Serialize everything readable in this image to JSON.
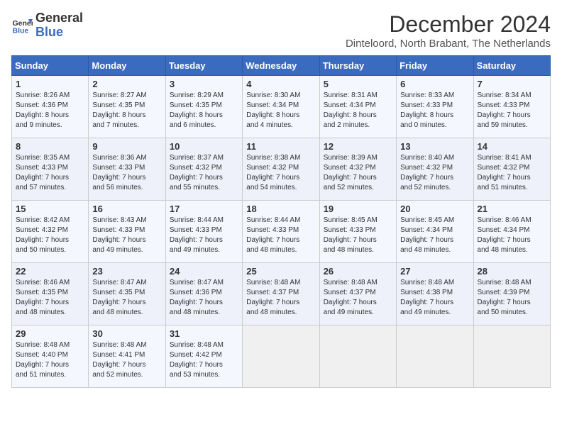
{
  "logo": {
    "line1": "General",
    "line2": "Blue"
  },
  "title": "December 2024",
  "subtitle": "Dinteloord, North Brabant, The Netherlands",
  "days_header": [
    "Sunday",
    "Monday",
    "Tuesday",
    "Wednesday",
    "Thursday",
    "Friday",
    "Saturday"
  ],
  "weeks": [
    [
      {
        "day": "1",
        "content": "Sunrise: 8:26 AM\nSunset: 4:36 PM\nDaylight: 8 hours\nand 9 minutes."
      },
      {
        "day": "2",
        "content": "Sunrise: 8:27 AM\nSunset: 4:35 PM\nDaylight: 8 hours\nand 7 minutes."
      },
      {
        "day": "3",
        "content": "Sunrise: 8:29 AM\nSunset: 4:35 PM\nDaylight: 8 hours\nand 6 minutes."
      },
      {
        "day": "4",
        "content": "Sunrise: 8:30 AM\nSunset: 4:34 PM\nDaylight: 8 hours\nand 4 minutes."
      },
      {
        "day": "5",
        "content": "Sunrise: 8:31 AM\nSunset: 4:34 PM\nDaylight: 8 hours\nand 2 minutes."
      },
      {
        "day": "6",
        "content": "Sunrise: 8:33 AM\nSunset: 4:33 PM\nDaylight: 8 hours\nand 0 minutes."
      },
      {
        "day": "7",
        "content": "Sunrise: 8:34 AM\nSunset: 4:33 PM\nDaylight: 7 hours\nand 59 minutes."
      }
    ],
    [
      {
        "day": "8",
        "content": "Sunrise: 8:35 AM\nSunset: 4:33 PM\nDaylight: 7 hours\nand 57 minutes."
      },
      {
        "day": "9",
        "content": "Sunrise: 8:36 AM\nSunset: 4:33 PM\nDaylight: 7 hours\nand 56 minutes."
      },
      {
        "day": "10",
        "content": "Sunrise: 8:37 AM\nSunset: 4:32 PM\nDaylight: 7 hours\nand 55 minutes."
      },
      {
        "day": "11",
        "content": "Sunrise: 8:38 AM\nSunset: 4:32 PM\nDaylight: 7 hours\nand 54 minutes."
      },
      {
        "day": "12",
        "content": "Sunrise: 8:39 AM\nSunset: 4:32 PM\nDaylight: 7 hours\nand 52 minutes."
      },
      {
        "day": "13",
        "content": "Sunrise: 8:40 AM\nSunset: 4:32 PM\nDaylight: 7 hours\nand 52 minutes."
      },
      {
        "day": "14",
        "content": "Sunrise: 8:41 AM\nSunset: 4:32 PM\nDaylight: 7 hours\nand 51 minutes."
      }
    ],
    [
      {
        "day": "15",
        "content": "Sunrise: 8:42 AM\nSunset: 4:32 PM\nDaylight: 7 hours\nand 50 minutes."
      },
      {
        "day": "16",
        "content": "Sunrise: 8:43 AM\nSunset: 4:33 PM\nDaylight: 7 hours\nand 49 minutes."
      },
      {
        "day": "17",
        "content": "Sunrise: 8:44 AM\nSunset: 4:33 PM\nDaylight: 7 hours\nand 49 minutes."
      },
      {
        "day": "18",
        "content": "Sunrise: 8:44 AM\nSunset: 4:33 PM\nDaylight: 7 hours\nand 48 minutes."
      },
      {
        "day": "19",
        "content": "Sunrise: 8:45 AM\nSunset: 4:33 PM\nDaylight: 7 hours\nand 48 minutes."
      },
      {
        "day": "20",
        "content": "Sunrise: 8:45 AM\nSunset: 4:34 PM\nDaylight: 7 hours\nand 48 minutes."
      },
      {
        "day": "21",
        "content": "Sunrise: 8:46 AM\nSunset: 4:34 PM\nDaylight: 7 hours\nand 48 minutes."
      }
    ],
    [
      {
        "day": "22",
        "content": "Sunrise: 8:46 AM\nSunset: 4:35 PM\nDaylight: 7 hours\nand 48 minutes."
      },
      {
        "day": "23",
        "content": "Sunrise: 8:47 AM\nSunset: 4:35 PM\nDaylight: 7 hours\nand 48 minutes."
      },
      {
        "day": "24",
        "content": "Sunrise: 8:47 AM\nSunset: 4:36 PM\nDaylight: 7 hours\nand 48 minutes."
      },
      {
        "day": "25",
        "content": "Sunrise: 8:48 AM\nSunset: 4:37 PM\nDaylight: 7 hours\nand 48 minutes."
      },
      {
        "day": "26",
        "content": "Sunrise: 8:48 AM\nSunset: 4:37 PM\nDaylight: 7 hours\nand 49 minutes."
      },
      {
        "day": "27",
        "content": "Sunrise: 8:48 AM\nSunset: 4:38 PM\nDaylight: 7 hours\nand 49 minutes."
      },
      {
        "day": "28",
        "content": "Sunrise: 8:48 AM\nSunset: 4:39 PM\nDaylight: 7 hours\nand 50 minutes."
      }
    ],
    [
      {
        "day": "29",
        "content": "Sunrise: 8:48 AM\nSunset: 4:40 PM\nDaylight: 7 hours\nand 51 minutes."
      },
      {
        "day": "30",
        "content": "Sunrise: 8:48 AM\nSunset: 4:41 PM\nDaylight: 7 hours\nand 52 minutes."
      },
      {
        "day": "31",
        "content": "Sunrise: 8:48 AM\nSunset: 4:42 PM\nDaylight: 7 hours\nand 53 minutes."
      },
      {
        "day": "",
        "content": ""
      },
      {
        "day": "",
        "content": ""
      },
      {
        "day": "",
        "content": ""
      },
      {
        "day": "",
        "content": ""
      }
    ]
  ]
}
